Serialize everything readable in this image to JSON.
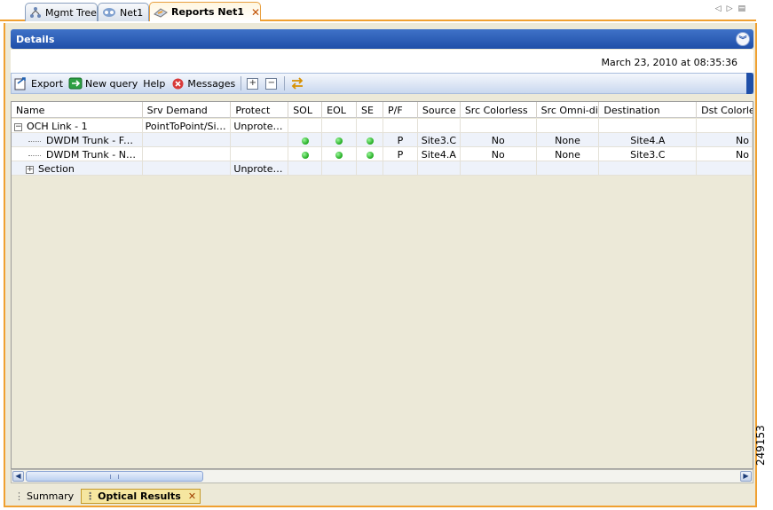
{
  "tabs": [
    {
      "label": "Mgmt Tree",
      "icon": "tree-icon"
    },
    {
      "label": "Net1",
      "icon": "network-icon"
    },
    {
      "label": "Reports Net1",
      "icon": "report-icon",
      "active": true
    }
  ],
  "details": {
    "title": "Details",
    "date": "March 23, 2010 at 08:35:36"
  },
  "toolbar": {
    "export_label": "Export",
    "new_query_label": "New query",
    "help_label": "Help",
    "messages_label": "Messages",
    "expand_symbol": "+",
    "collapse_symbol": "−"
  },
  "grid": {
    "columns": [
      "Name",
      "Srv Demand",
      "Protect",
      "SOL",
      "EOL",
      "SE",
      "P/F",
      "Source",
      "Src Colorless",
      "Src Omni-dir",
      "Destination",
      "Dst Colorle"
    ],
    "rows": [
      {
        "name": "OCH Link - 1",
        "srv_demand": "PointToPoint/Site...",
        "protect": "Unprotected",
        "sol": "",
        "eol": "",
        "se": "",
        "pf": "",
        "source": "",
        "src_colorless": "",
        "src_omni": "",
        "destination": "",
        "dst_colorless": "",
        "expander": "−"
      },
      {
        "name": "DWDM Trunk - Far End",
        "srv_demand": "",
        "protect": "",
        "sol": "ok",
        "eol": "ok",
        "se": "ok",
        "pf": "P",
        "source": "Site3.C",
        "src_colorless": "No",
        "src_omni": "None",
        "destination": "Site4.A",
        "dst_colorless": "No"
      },
      {
        "name": "DWDM Trunk - Near End",
        "srv_demand": "",
        "protect": "",
        "sol": "ok",
        "eol": "ok",
        "se": "ok",
        "pf": "P",
        "source": "Site4.A",
        "src_colorless": "No",
        "src_omni": "None",
        "destination": "Site3.C",
        "dst_colorless": "No"
      },
      {
        "name": "Section",
        "srv_demand": "",
        "protect": "Unprotected",
        "sol": "",
        "eol": "",
        "se": "",
        "pf": "",
        "source": "",
        "src_colorless": "",
        "src_omni": "",
        "destination": "",
        "dst_colorless": "",
        "expander": "+"
      }
    ],
    "status_color": "#1ea91e"
  },
  "bottom_tabs": {
    "summary": "Summary",
    "optical": "Optical Results"
  },
  "side_id": "249153",
  "colors": {
    "accent_orange": "#f0a030",
    "header_blue": "#1f4fa8"
  }
}
